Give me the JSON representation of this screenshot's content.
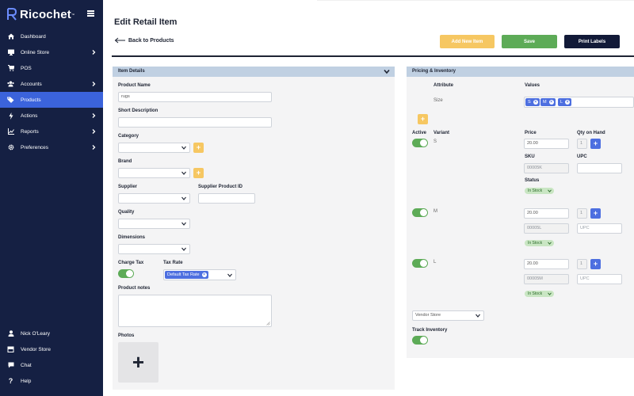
{
  "app": {
    "name": "Ricochet",
    "trademark": "™"
  },
  "sidebar": {
    "items": [
      {
        "label": "Dashboard",
        "icon": "home-icon"
      },
      {
        "label": "Online Store",
        "icon": "monitor-icon",
        "has_chevron": true
      },
      {
        "label": "POS",
        "icon": "cart-icon"
      },
      {
        "label": "Accounts",
        "icon": "users-icon",
        "has_chevron": true
      },
      {
        "label": "Products",
        "icon": "tag-icon",
        "active": true
      },
      {
        "label": "Actions",
        "icon": "bolt-icon",
        "has_chevron": true
      },
      {
        "label": "Reports",
        "icon": "chart-icon",
        "has_chevron": true
      },
      {
        "label": "Preferences",
        "icon": "gear-icon",
        "has_chevron": true
      }
    ],
    "bottom_items": [
      {
        "label": "Nick O'Leary",
        "icon": "user-icon"
      },
      {
        "label": "Vendor Store",
        "icon": "store-icon"
      },
      {
        "label": "Chat",
        "icon": "chat-icon"
      },
      {
        "label": "Help",
        "icon": "help-icon"
      }
    ]
  },
  "header": {
    "title": "Edit Retail Item",
    "back_label": "Back to Products",
    "add_new_label": "Add New Item",
    "save_label": "Save",
    "print_label": "Print Labels"
  },
  "item_details": {
    "section_title": "Item Details",
    "product_name_label": "Product Name",
    "product_name_value": "rugs",
    "short_description_label": "Short Description",
    "short_description_value": "",
    "category_label": "Category",
    "category_value": "",
    "brand_label": "Brand",
    "brand_value": "",
    "supplier_label": "Supplier",
    "supplier_value": "",
    "supplier_product_id_label": "Supplier Product ID",
    "supplier_product_id_value": "",
    "quality_label": "Quality",
    "quality_value": "",
    "dimensions_label": "Dimensions",
    "dimensions_value": "",
    "charge_tax_label": "Charge Tax",
    "charge_tax_on": true,
    "tax_rate_label": "Tax Rate",
    "tax_rate_chip": "Default Tax Rate",
    "product_notes_label": "Product notes",
    "product_notes_value": "",
    "photos_label": "Photos",
    "add_photo_symbol": "+"
  },
  "pricing": {
    "section_title": "Pricing & Inventory",
    "attribute_header": "Attribute",
    "values_header": "Values",
    "attribute_name": "Size",
    "size_values": [
      "S",
      "M",
      "L"
    ],
    "active_header": "Active",
    "variant_header": "Variant",
    "price_header": "Price",
    "qty_header": "Qty on Hand",
    "sku_header": "SKU",
    "upc_header": "UPC",
    "status_header": "Status",
    "upc_placeholder": "UPC",
    "variants": [
      {
        "name": "S",
        "active": true,
        "price": "20.00",
        "qty": "1",
        "sku": "00005K",
        "upc": "",
        "status": "In Stock"
      },
      {
        "name": "M",
        "active": true,
        "price": "20.00",
        "qty": "1",
        "sku": "00005L",
        "upc": "",
        "status": "In Stock"
      },
      {
        "name": "L",
        "active": true,
        "price": "20.00",
        "qty": "1",
        "sku": "00005M",
        "upc": "",
        "status": "In Stock"
      }
    ],
    "vendor_store_value": "Vendor Store",
    "track_inventory_label": "Track Inventory",
    "track_inventory_on": true
  },
  "colors": {
    "sidebar_bg": "#152043",
    "active_nav": "#3b63db",
    "add_button": "#f6c762",
    "save_button": "#5dab57",
    "print_button": "#121a38",
    "panel_header": "#c0d0e2",
    "chip_blue": "#4d6fe0",
    "status_green": "#c9e6c3"
  }
}
